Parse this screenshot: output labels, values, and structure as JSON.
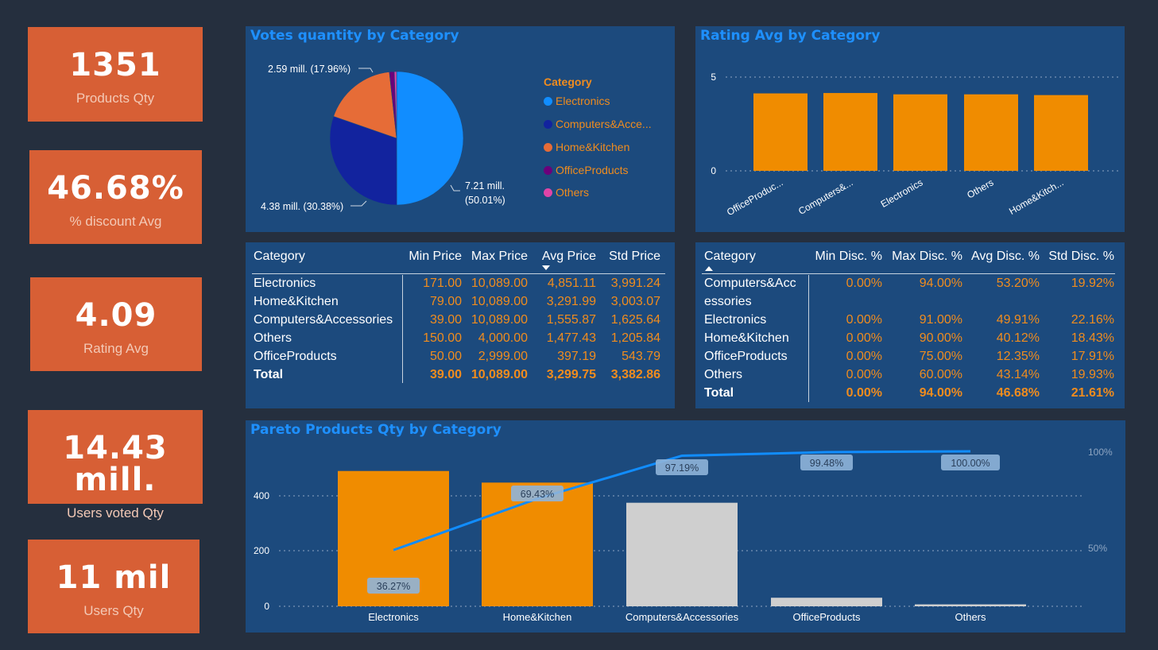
{
  "kpis": [
    {
      "value": "1351",
      "label": "Products Qty"
    },
    {
      "value": "46.68%",
      "label": "% discount Avg"
    },
    {
      "value": "4.09",
      "label": "Rating Avg"
    },
    {
      "value": "14.43 mill.",
      "label": "Users voted Qty"
    },
    {
      "value": "11 mil",
      "label": "Users Qty"
    }
  ],
  "votes": {
    "title": "Votes quantity by Category",
    "legend_title": "Category",
    "legend": [
      "Electronics",
      "Computers&Acce...",
      "Home&Kitchen",
      "OfficeProducts",
      "Others"
    ],
    "labels": {
      "home": "2.59 mill. (17.96%)",
      "computers": "4.38 mill. (30.38%)",
      "electronics_1": "7.21 mill.",
      "electronics_2": "(50.01%)"
    },
    "colors": {
      "Electronics": "#118dff",
      "Computers": "#12239e",
      "Home": "#e66c37",
      "Office": "#6b007b",
      "Others": "#e044a7"
    }
  },
  "rating": {
    "title": "Rating Avg by Category",
    "y_ticks": [
      "5",
      "0"
    ],
    "categories": [
      "OfficeProduc...",
      "Computers&...",
      "Electronics",
      "Others",
      "Home&Kitch..."
    ]
  },
  "price_table": {
    "headers": [
      "Category",
      "Min Price",
      "Max Price",
      "Avg Price",
      "Std Price"
    ],
    "rows": [
      [
        "Electronics",
        "171.00",
        "10,089.00",
        "4,851.11",
        "3,991.24"
      ],
      [
        "Home&Kitchen",
        "79.00",
        "10,089.00",
        "3,291.99",
        "3,003.07"
      ],
      [
        "Computers&Accessories",
        "39.00",
        "10,089.00",
        "1,555.87",
        "1,625.64"
      ],
      [
        "Others",
        "150.00",
        "4,000.00",
        "1,477.43",
        "1,205.84"
      ],
      [
        "OfficeProducts",
        "50.00",
        "2,999.00",
        "397.19",
        "543.79"
      ]
    ],
    "total": [
      "Total",
      "39.00",
      "10,089.00",
      "3,299.75",
      "3,382.86"
    ]
  },
  "disc_table": {
    "headers": [
      "Category",
      "Min Disc. %",
      "Max Disc. %",
      "Avg Disc. %",
      "Std Disc. %"
    ],
    "rows": [
      [
        "Computers&Acc",
        "0.00%",
        "94.00%",
        "53.20%",
        "19.92%"
      ],
      [
        "essories",
        "",
        "",
        "",
        ""
      ],
      [
        "Electronics",
        "0.00%",
        "91.00%",
        "49.91%",
        "22.16%"
      ],
      [
        "Home&Kitchen",
        "0.00%",
        "90.00%",
        "40.12%",
        "18.43%"
      ],
      [
        "OfficeProducts",
        "0.00%",
        "75.00%",
        "12.35%",
        "17.91%"
      ],
      [
        "Others",
        "0.00%",
        "60.00%",
        "43.14%",
        "19.93%"
      ]
    ],
    "total": [
      "Total",
      "0.00%",
      "94.00%",
      "46.68%",
      "21.61%"
    ]
  },
  "pareto": {
    "title": "Pareto Products Qty by Category",
    "y_ticks": [
      "400",
      "200",
      "0"
    ],
    "y2_ticks": [
      "100%",
      "50%"
    ],
    "categories": [
      "Electronics",
      "Home&Kitchen",
      "Computers&Accessories",
      "OfficeProducts",
      "Others"
    ],
    "cum_labels": [
      "36.27%",
      "69.43%",
      "97.19%",
      "99.48%",
      "100.00%"
    ]
  },
  "chart_data": [
    {
      "type": "pie",
      "title": "Votes quantity by Category",
      "categories": [
        "Electronics",
        "Computers&Accessories",
        "Home&Kitchen",
        "OfficeProducts",
        "Others"
      ],
      "values": [
        7.21,
        4.38,
        2.59,
        0.17,
        0.08
      ],
      "percent": [
        50.01,
        30.38,
        17.96,
        1.2,
        0.45
      ],
      "unit": "mill."
    },
    {
      "type": "bar",
      "title": "Rating Avg by Category",
      "categories": [
        "OfficeProducts",
        "Computers&Accessories",
        "Electronics",
        "Others",
        "Home&Kitchen"
      ],
      "values": [
        4.13,
        4.15,
        4.08,
        4.08,
        4.04
      ],
      "ylim": [
        0,
        5
      ]
    },
    {
      "type": "bar",
      "title": "Pareto Products Qty by Category",
      "categories": [
        "Electronics",
        "Home&Kitchen",
        "Computers&Accessories",
        "OfficeProducts",
        "Others"
      ],
      "series": [
        {
          "values": [
            490,
            448,
            375,
            31,
            7
          ]
        },
        {
          "values": [
            36.27,
            69.43,
            97.19,
            99.48,
            100.0
          ]
        }
      ],
      "ylim": [
        0,
        500
      ],
      "y2lim": [
        0,
        100
      ]
    }
  ]
}
